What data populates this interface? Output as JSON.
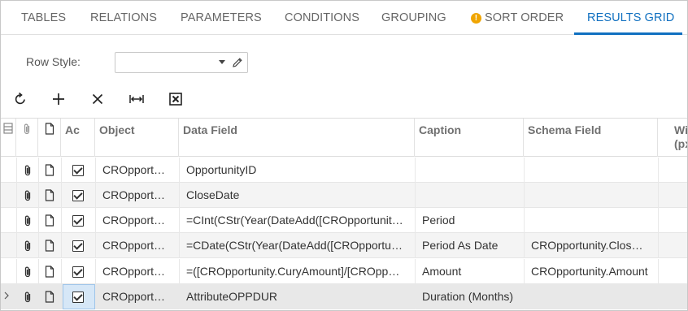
{
  "tabs": [
    {
      "label": "TABLES"
    },
    {
      "label": "RELATIONS"
    },
    {
      "label": "PARAMETERS"
    },
    {
      "label": "CONDITIONS"
    },
    {
      "label": "GROUPING"
    },
    {
      "label": "SORT ORDER",
      "warning": true
    },
    {
      "label": "RESULTS GRID",
      "active": true
    }
  ],
  "row_style": {
    "label": "Row Style:",
    "value": ""
  },
  "toolbar": {
    "refresh_icon": "refresh-icon",
    "add_icon": "plus-icon",
    "delete_icon": "close-icon",
    "fit_icon": "fit-width-icon",
    "excel_icon": "export-excel-icon"
  },
  "grid": {
    "columns": {
      "active": "Ac",
      "object": "Object",
      "data_field": "Data Field",
      "caption": "Caption",
      "schema_field": "Schema Field",
      "width": "Wi",
      "width_line2": "(px"
    },
    "rows": [
      {
        "object": "CROpport…",
        "data_field": "OpportunityID",
        "caption": "",
        "schema_field": "",
        "active": true
      },
      {
        "object": "CROpport…",
        "data_field": "CloseDate",
        "caption": "",
        "schema_field": "",
        "active": true
      },
      {
        "object": "CROpport…",
        "data_field": "=CInt(CStr(Year(DateAdd([CROpportunit…",
        "caption": "Period",
        "schema_field": "",
        "active": true
      },
      {
        "object": "CROpport…",
        "data_field": "=CDate(CStr(Year(DateAdd([CROpportu…",
        "caption": "Period As Date",
        "schema_field": "CROpportunity.Clos…",
        "active": true
      },
      {
        "object": "CROpport…",
        "data_field": "=([CROpportunity.CuryAmount]/[CROpp…",
        "caption": "Amount",
        "schema_field": "CROpportunity.Amount",
        "active": true
      },
      {
        "object": "CROpport…",
        "data_field": "AttributeOPPDUR",
        "caption": "Duration (Months)",
        "schema_field": "",
        "active": true
      }
    ]
  },
  "colors": {
    "accent": "#1070c0",
    "warning": "#f0a500"
  }
}
